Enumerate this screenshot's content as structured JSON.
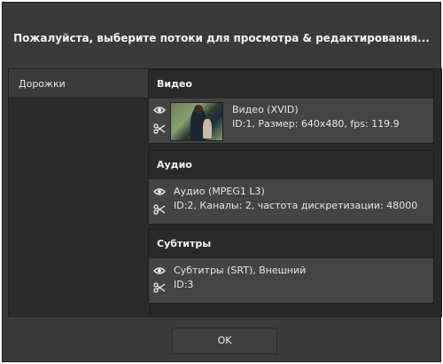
{
  "dialog": {
    "title": "Пожалуйста, выберите потоки для просмотра & редактирования..."
  },
  "sidebar": {
    "items": [
      {
        "label": "Дорожки"
      }
    ]
  },
  "sections": {
    "video": {
      "header": "Видео",
      "line1": "Видео (XVID)",
      "line2": "ID:1, Размер: 640x480, fps: 119.9"
    },
    "audio": {
      "header": "Аудио",
      "line1": "Аудио (MPEG1 L3)",
      "line2": "ID:2, Каналы: 2, частота дискретизации: 48000"
    },
    "subtitles": {
      "header": "Субтитры",
      "line1": "Субтитры (SRT), Внешний",
      "line2": "ID:3"
    }
  },
  "footer": {
    "ok_label": "OK"
  }
}
